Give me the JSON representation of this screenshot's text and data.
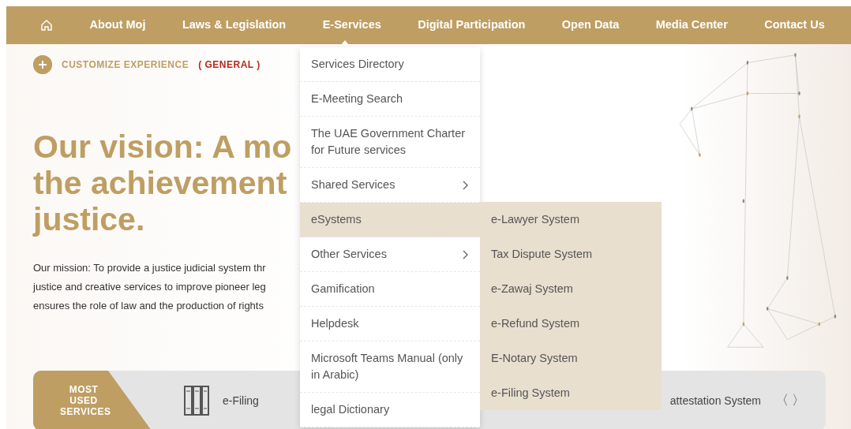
{
  "nav": {
    "items": [
      {
        "label": "About Moj"
      },
      {
        "label": "Laws & Legislation"
      },
      {
        "label": "E-Services"
      },
      {
        "label": "Digital Participation"
      },
      {
        "label": "Open Data"
      },
      {
        "label": "Media Center"
      },
      {
        "label": "Contact Us"
      }
    ]
  },
  "customize": {
    "label": "CUSTOMIZE EXPERIENCE",
    "mode": "( GENERAL )"
  },
  "hero": {
    "vision_lines": [
      "Our vision: A mo",
      "the achievement",
      "justice."
    ],
    "mission_lines": [
      "Our mission: To provide a justice judicial system thr",
      "justice and creative services to improve pioneer leg",
      "ensures the role of law and the production of rights"
    ]
  },
  "dropdown": {
    "items": [
      {
        "label": "Services Directory",
        "has_submenu": false,
        "selected": false
      },
      {
        "label": "E-Meeting Search",
        "has_submenu": false,
        "selected": false
      },
      {
        "label": "The UAE Government Charter for Future services",
        "has_submenu": false,
        "selected": false
      },
      {
        "label": "Shared Services",
        "has_submenu": true,
        "selected": false
      },
      {
        "label": "eSystems",
        "has_submenu": false,
        "selected": true
      },
      {
        "label": "Other Services",
        "has_submenu": true,
        "selected": false
      },
      {
        "label": "Gamification",
        "has_submenu": false,
        "selected": false
      },
      {
        "label": "Helpdesk",
        "has_submenu": false,
        "selected": false
      },
      {
        "label": "Microsoft Teams Manual (only in Arabic)",
        "has_submenu": false,
        "selected": false
      },
      {
        "label": "legal Dictionary",
        "has_submenu": false,
        "selected": false
      }
    ],
    "submenu": [
      "e-Lawyer System",
      "Tax Dispute System",
      "e-Zawaj System",
      "e-Refund System",
      "E-Notary System",
      "e-Filing System"
    ]
  },
  "services_bar": {
    "title": "MOST USED SERVICES",
    "items": [
      "e-Filing",
      "attestation System"
    ],
    "prev": "〈",
    "next": "〉"
  }
}
